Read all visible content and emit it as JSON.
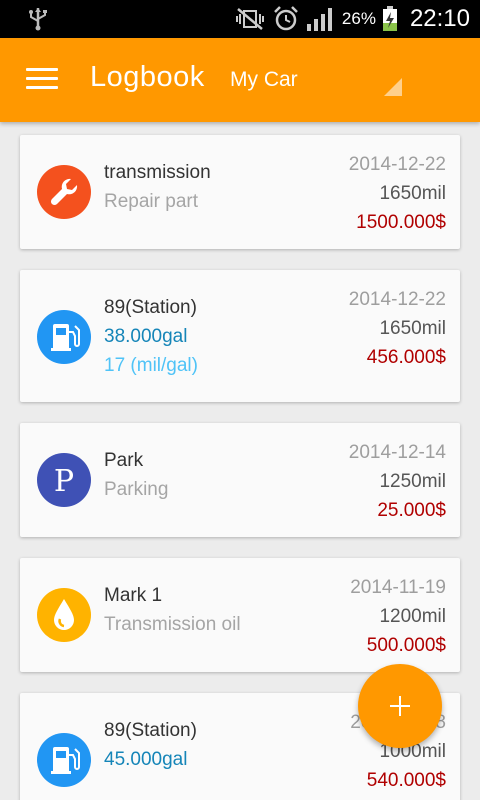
{
  "status_bar": {
    "battery_percent": "26%",
    "time": "22:10"
  },
  "app_bar": {
    "title": "Logbook",
    "car_selector": "My Car"
  },
  "entries": [
    {
      "icon": "wrench-icon",
      "title": "transmission",
      "subtitle": "Repair part",
      "date": "2014-12-22",
      "odometer": "1650mil",
      "cost": "1500.000$"
    },
    {
      "icon": "fuel-pump-icon",
      "title": "89(Station)",
      "subtitle": "38.000gal",
      "consumption": "17 (mil/gal)",
      "date": "2014-12-22",
      "odometer": "1650mil",
      "cost": "456.000$"
    },
    {
      "icon": "parking-icon",
      "title": "Park",
      "subtitle": "Parking",
      "date": "2014-12-14",
      "odometer": "1250mil",
      "cost": "25.000$"
    },
    {
      "icon": "oil-drop-icon",
      "title": "Mark 1",
      "subtitle": "Transmission oil",
      "date": "2014-11-19",
      "odometer": "1200mil",
      "cost": "500.000$"
    },
    {
      "icon": "fuel-pump-icon",
      "title": "89(Station)",
      "subtitle": "45.000gal",
      "date": "2014-11-18",
      "odometer": "1000mil",
      "cost": "540.000$"
    }
  ],
  "colors": {
    "accent": "#ff9800",
    "cost": "#b00000",
    "fuel_amount": "#1585b8",
    "consumption": "#4fc3f7"
  }
}
